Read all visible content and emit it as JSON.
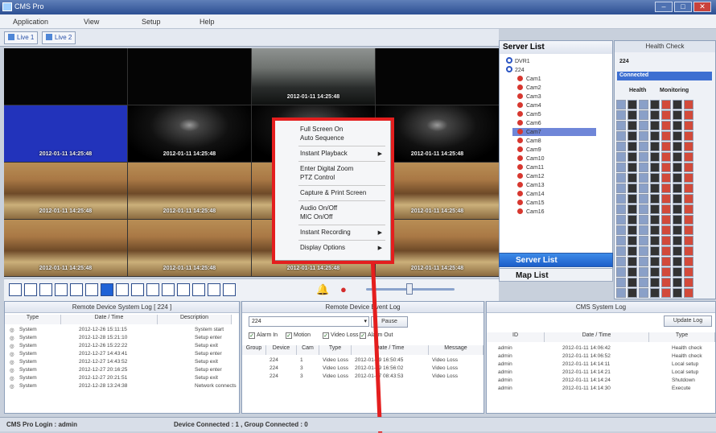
{
  "window": {
    "title": "CMS Pro"
  },
  "menu": [
    "Application",
    "View",
    "Setup",
    "Help"
  ],
  "tabs": [
    "Live 1",
    "Live 2"
  ],
  "video_grid": {
    "cells": [
      {
        "style": "cam-black",
        "ts": ""
      },
      {
        "style": "cam-black",
        "ts": ""
      },
      {
        "style": "cam-lot",
        "ts": "2012-01-11 14:25:48"
      },
      {
        "style": "cam-black",
        "ts": ""
      },
      {
        "style": "cam-blue",
        "ts": "2012-01-11 14:25:48"
      },
      {
        "style": "cam-dark",
        "ts": "2012-01-11 14:25:48"
      },
      {
        "style": "cam-dark",
        "ts": "2012-01-11 14:25:48"
      },
      {
        "style": "cam-dark",
        "ts": "2012-01-11 14:25:48"
      },
      {
        "style": "cam-mater",
        "ts": "2012-01-11 14:25:48"
      },
      {
        "style": "cam-mater",
        "ts": "2012-01-11 14:25:48"
      },
      {
        "style": "cam-mater",
        "ts": "2012-01-11 14:25:48"
      },
      {
        "style": "cam-mater",
        "ts": "2012-01-11 14:25:48"
      },
      {
        "style": "cam-mater",
        "ts": "2012-01-11 14:25:48"
      },
      {
        "style": "cam-mater",
        "ts": "2012-01-11 14:25:48"
      },
      {
        "style": "cam-mater",
        "ts": "2012-01-11 14:25:48"
      },
      {
        "style": "cam-mater",
        "ts": "2012-01-11 14:25:48"
      }
    ]
  },
  "context_menu": {
    "items": [
      {
        "label": "Full Screen On",
        "submenu": false,
        "sep_after": false
      },
      {
        "label": "Auto Sequence",
        "submenu": false,
        "sep_after": true
      },
      {
        "label": "Instant Playback",
        "submenu": true,
        "sep_after": true
      },
      {
        "label": "Enter Digital Zoom",
        "submenu": false,
        "sep_after": false
      },
      {
        "label": "PTZ Control",
        "submenu": false,
        "sep_after": true
      },
      {
        "label": "Capture & Print Screen",
        "submenu": false,
        "sep_after": true
      },
      {
        "label": "Audio On/Off",
        "submenu": false,
        "sep_after": false
      },
      {
        "label": "MIC On/Off",
        "submenu": false,
        "sep_after": true
      },
      {
        "label": "Instant Recording",
        "submenu": true,
        "sep_after": true
      },
      {
        "label": "Display Options",
        "submenu": true,
        "sep_after": false
      }
    ]
  },
  "server_list": {
    "title": "Server List",
    "groups": [
      "DVR1",
      "224"
    ],
    "cams": [
      "Cam1",
      "Cam2",
      "Cam3",
      "Cam4",
      "Cam5",
      "Cam6",
      "Cam7",
      "Cam8",
      "Cam9",
      "Cam10",
      "Cam11",
      "Cam12",
      "Cam13",
      "Cam14",
      "Cam15",
      "Cam16"
    ],
    "selected_cam": "Cam7",
    "server_list_btn": "Server List",
    "map_list_btn": "Map List"
  },
  "health_check": {
    "title": "Health Check",
    "device": "224",
    "status": "Connected",
    "col_health": "Health",
    "col_monitoring": "Monitoring"
  },
  "remote_system_log": {
    "title": "Remote Device System Log [ 224 ]",
    "columns": [
      "Type",
      "Date / Time",
      "Description"
    ],
    "rows": [
      [
        "System",
        "2012-12-26 15:11:15",
        "System start"
      ],
      [
        "System",
        "2012-12-28 15:21:10",
        "Setup enter"
      ],
      [
        "System",
        "2012-12-26 15:22:22",
        "Setup exit"
      ],
      [
        "System",
        "2012-12-27 14:43:41",
        "Setup enter"
      ],
      [
        "System",
        "2012-12-27 14:43:52",
        "Setup exit"
      ],
      [
        "System",
        "2012-12-27 20:16:25",
        "Setup enter"
      ],
      [
        "System",
        "2012-12-27 20:21:51",
        "Setup exit"
      ],
      [
        "System",
        "2012-12-28 13:24:38",
        "Network connects"
      ]
    ]
  },
  "remote_event_log": {
    "title": "Remote Device Event Log",
    "device_select": "224",
    "pause_label": "Pause",
    "filters": [
      "Alarm In",
      "Motion",
      "Video Loss",
      "Alarm Out"
    ],
    "columns": [
      "Group",
      "Device",
      "Cam",
      "Type",
      "Date / Time",
      "Message"
    ],
    "rows": [
      [
        "",
        "224",
        "1",
        "Video Loss",
        "2012-01-09 16:50:45",
        "Video Loss"
      ],
      [
        "",
        "224",
        "3",
        "Video Loss",
        "2012-01-09 16:56:02",
        "Video Loss"
      ],
      [
        "",
        "224",
        "3",
        "Video Loss",
        "2012-01-07 08:43:53",
        "Video Loss"
      ]
    ]
  },
  "cms_system_log": {
    "title": "CMS System Log",
    "update_label": "Update Log",
    "columns": [
      "ID",
      "Date / Time",
      "Type"
    ],
    "rows": [
      [
        "admin",
        "2012-01-11 14:06:42",
        "Health check"
      ],
      [
        "admin",
        "2012-01-11 14:06:52",
        "Health check"
      ],
      [
        "admin",
        "2012-01-11 14:14:11",
        "Local setup"
      ],
      [
        "admin",
        "2012-01-11 14:14:21",
        "Local setup"
      ],
      [
        "admin",
        "2012-01-11 14:14:24",
        "Shutdown"
      ],
      [
        "admin",
        "2012-01-11 14:14:30",
        "Execute"
      ]
    ]
  },
  "status": {
    "login": "CMS Pro Login : admin",
    "connection": "Device Connected : 1 , Group Connected : 0"
  }
}
